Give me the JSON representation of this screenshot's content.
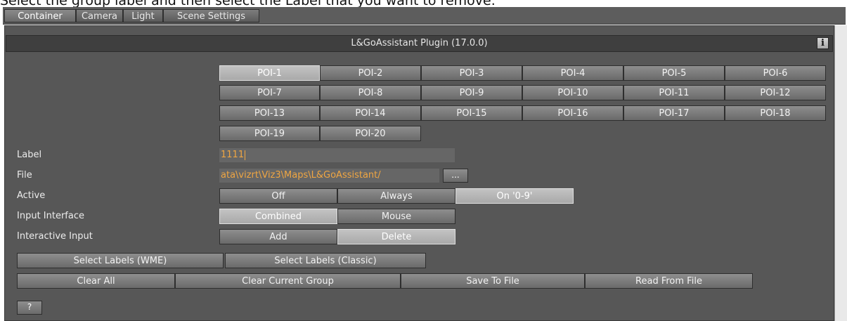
{
  "caption": "Select the group label and then select the Label that you want to remove.",
  "tabs": [
    "Container",
    "Camera",
    "Light",
    "Scene Settings"
  ],
  "plugin_title": "L&GoAssistant Plugin (17.0.0)",
  "info_icon": "i",
  "poi_buttons": [
    "POI-1",
    "POI-2",
    "POI-3",
    "POI-4",
    "POI-5",
    "POI-6",
    "POI-7",
    "POI-8",
    "POI-9",
    "POI-10",
    "POI-11",
    "POI-12",
    "POI-13",
    "POI-14",
    "POI-15",
    "POI-16",
    "POI-17",
    "POI-18",
    "POI-19",
    "POI-20"
  ],
  "selected_poi": "POI-1",
  "label": {
    "caption": "Label",
    "value": "1111"
  },
  "file": {
    "caption": "File",
    "value": "ata\\vizrt\\Viz3\\Maps\\L&GoAssistant/",
    "browse": "..."
  },
  "active": {
    "caption": "Active",
    "options": [
      "Off",
      "Always",
      "On '0-9'"
    ],
    "selected": "On '0-9'"
  },
  "input_interface": {
    "caption": "Input Interface",
    "options": [
      "Combined",
      "Mouse"
    ],
    "selected": "Combined"
  },
  "interactive_input": {
    "caption": "Interactive Input",
    "options": [
      "Add",
      "Delete"
    ],
    "selected": "Delete"
  },
  "select_labels": [
    "Select Labels (WME)",
    "Select Labels (Classic)"
  ],
  "actions": [
    "Clear All",
    "Clear Current Group",
    "Save To File",
    "Read From File"
  ],
  "help": "?"
}
